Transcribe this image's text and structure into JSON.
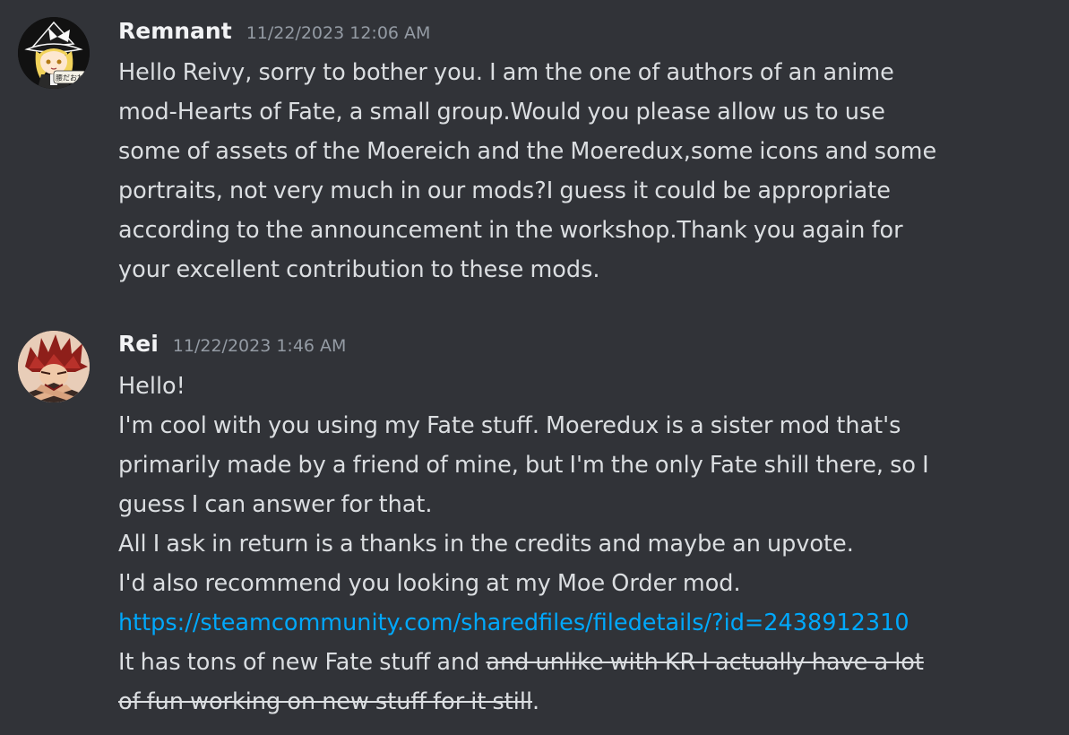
{
  "messages": [
    {
      "username": "Remnant",
      "timestamp": "11/22/2023 12:06 AM",
      "avatar_badge": "腰だおね",
      "lines": [
        "Hello Reivy, sorry to bother you. I am the one of authors of an anime",
        "mod-Hearts of Fate, a small group.Would you please allow us to use",
        "some of assets of the Moereich and the Moeredux,some icons and some",
        "portraits, not very much in our mods?I guess it could be appropriate",
        "according to the announcement in the workshop.Thank you again for",
        "your excellent contribution to these mods."
      ]
    },
    {
      "username": "Rei",
      "timestamp": "11/22/2023 1:46 AM",
      "lines": [
        "Hello!",
        "I'm cool with you using my Fate stuff. Moeredux is a sister mod that's",
        "primarily made by  a friend of mine, but I'm the only Fate shill there, so I",
        "guess I can answer for that.",
        "All I ask in return is a thanks in the credits and maybe an upvote.",
        "I'd also recommend you looking at my Moe Order mod."
      ],
      "link": "https://steamcommunity.com/sharedfiles/filedetails/?id=2438912310",
      "last_line_plain": "It has tons of new Fate stuff and ",
      "last_line_struck_1": "and unlike with KR I actually have a lot",
      "last_line_struck_2": "of fun working on new stuff for it still",
      "last_line_end": "."
    }
  ],
  "colors": {
    "background": "#313338",
    "text": "#dbdee1",
    "username": "#f2f3f5",
    "timestamp": "#949ba4",
    "link": "#00a8fc"
  }
}
